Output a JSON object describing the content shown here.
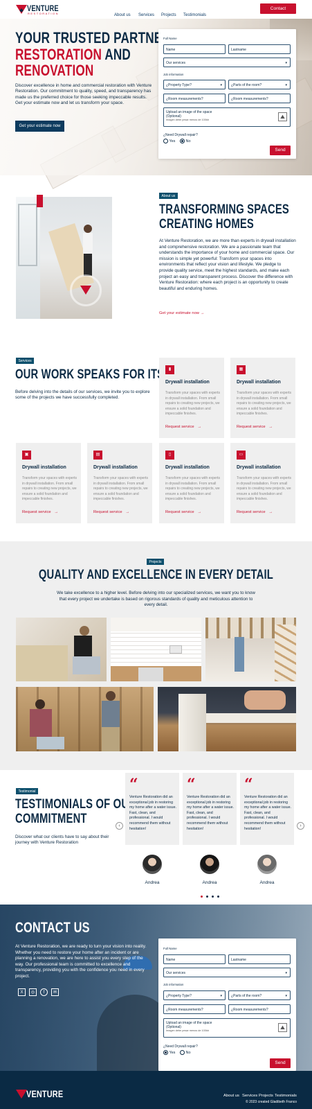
{
  "header": {
    "logo_text": "VENTURE",
    "logo_sub": "RESTORATION",
    "nav": [
      "About us",
      "Services",
      "Projects",
      "Testimonials"
    ],
    "contact_button": "Contact"
  },
  "hero": {
    "title_line1": "YOUR TRUSTED PARTNER IN",
    "title_line2_red": "RESTORATION",
    "title_line2_rest": " AND",
    "title_line3_red": "RENOVATION",
    "paragraph": "Discover excellence in home and commercial restoration with Venture Restoration. Our commitment to quality, speed, and transparency has made us the preferred choice for those seeking impeccable results. Get your estimate now and let us transform your space.",
    "cta": "Get your estimate now"
  },
  "form": {
    "full_name_label": "Full Name",
    "name_placeholder": "Name",
    "lastname_placeholder": "Lastname",
    "services_select": "Our services",
    "job_info_label": "Job information",
    "property_type": "¿Property Type?",
    "parts_of_room": "¿Parts of the room?",
    "room_measurements_1": "¿Room measurements?",
    "room_measurements_2": "¿Room measurements?",
    "upload_title": "Upload an image of the space",
    "upload_optional": "(Optional)",
    "upload_hint": "Imagen debe pesar menos de 100kb",
    "drywall_question": "¿Need Drywall repair?",
    "yes": "Yes",
    "no": "No",
    "send": "Send"
  },
  "about": {
    "tag": "About us",
    "title_line1": "TRANSFORMING SPACES",
    "title_line2": "CREATING HOMES",
    "paragraph": "At Venture Restoration, we are more than experts in drywall installation and comprehensive restoration. We are a passionate team that understands the importance of your home and commercial space. Our mission is simple yet powerful: Transform your spaces into environments that reflect your vision and lifestyle. We pledge to provide quality service, meet the highest standards, and make each project an easy and transparent process. Discover the difference with Venture Restoration: where each project is an opportunity to create beautiful and enduring homes.",
    "cta": "Get your estimate now"
  },
  "services": {
    "tag": "Services",
    "title": "OUR WORK SPEAKS FOR ITSELF",
    "paragraph": "Before delving into the details of our services, we invite you to explore some of the projects we have successfully completed.",
    "cards": [
      {
        "title": "Drywall installation",
        "desc": "Transform your spaces with experts in drywall installation. From small repairs to creating new projects, we ensure a solid foundation and impeccable finishes.",
        "link": "Request service",
        "icon": "drywall-icon"
      },
      {
        "title": "Drywall installation",
        "desc": "Transform your spaces with experts in drywall installation. From small repairs to creating new projects, we ensure a solid foundation and impeccable finishes.",
        "link": "Request service",
        "icon": "grid-icon"
      },
      {
        "title": "Drywall installation",
        "desc": "Transform your spaces with experts in drywall installation. From small repairs to creating new projects, we ensure a solid foundation and impeccable finishes.",
        "link": "Request service",
        "icon": "toolbox-icon"
      },
      {
        "title": "Drywall installation",
        "desc": "Transform your spaces with experts in drywall installation. From small repairs to creating new projects, we ensure a solid foundation and impeccable finishes.",
        "link": "Request service",
        "icon": "paint-roller-icon"
      },
      {
        "title": "Drywall installation",
        "desc": "Transform your spaces with experts in drywall installation. From small repairs to creating new projects, we ensure a solid foundation and impeccable finishes.",
        "link": "Request service",
        "icon": "door-icon"
      },
      {
        "title": "Drywall installation",
        "desc": "Transform your spaces with experts in drywall installation. From small repairs to creating new projects, we ensure a solid foundation and impeccable finishes.",
        "link": "Request service",
        "icon": "cabinet-icon"
      }
    ]
  },
  "projects": {
    "tag": "Projects",
    "title": "QUALITY AND EXCELLENCE IN EVERY DETAIL",
    "paragraph": "We take excellence to a higher level. Before delving into our specialized services, we want you to know that every project we undertake is based on rigorous standards of quality and meticulous attention to every detail."
  },
  "testimonials": {
    "tag": "Testimonial",
    "title_line1": "TESTIMONIALS OF OUR",
    "title_line2": "COMMITMENT",
    "paragraph": "Discover what our clients have to say about their journey with Venture Restoration",
    "items": [
      {
        "text": "Venture Restoration did an exceptional job in restoring my home after a water issue. Fast, clean, and professional. I would recommend them without hesitation!",
        "name": "Andrea"
      },
      {
        "text": "Venture Restoration did an exceptional job in restoring my home after a water issue. Fast, clean, and professional. I would recommend them without hesitation!",
        "name": "Andrea"
      },
      {
        "text": "Venture Restoration did an exceptional job in restoring my home after a water issue. Fast, clean, and professional. I would recommend them without hesitation!",
        "name": "Andrea"
      }
    ]
  },
  "contact": {
    "title": "CONTACT US",
    "paragraph": "At Venture Restoration, we are ready to turn your vision into reality. Whether you need to restore your home after an incident or are planning a renovation, we are here to assist you every step of the way. Our professional team is committed to excellence and transparency, providing you with the confidence you need in every project.",
    "social": [
      "x-icon",
      "instagram-icon",
      "facebook-icon",
      "email-icon"
    ]
  },
  "footer": {
    "logo_text": "VENTURE",
    "nav": [
      "About us",
      "Services",
      "Projects",
      "Testimonials"
    ],
    "copyright": "© 2023 created Gladibeth Franco"
  },
  "colors": {
    "brand_red": "#c8102e",
    "navy": "#0d2b45",
    "teal_tag": "#0d4f6c"
  }
}
